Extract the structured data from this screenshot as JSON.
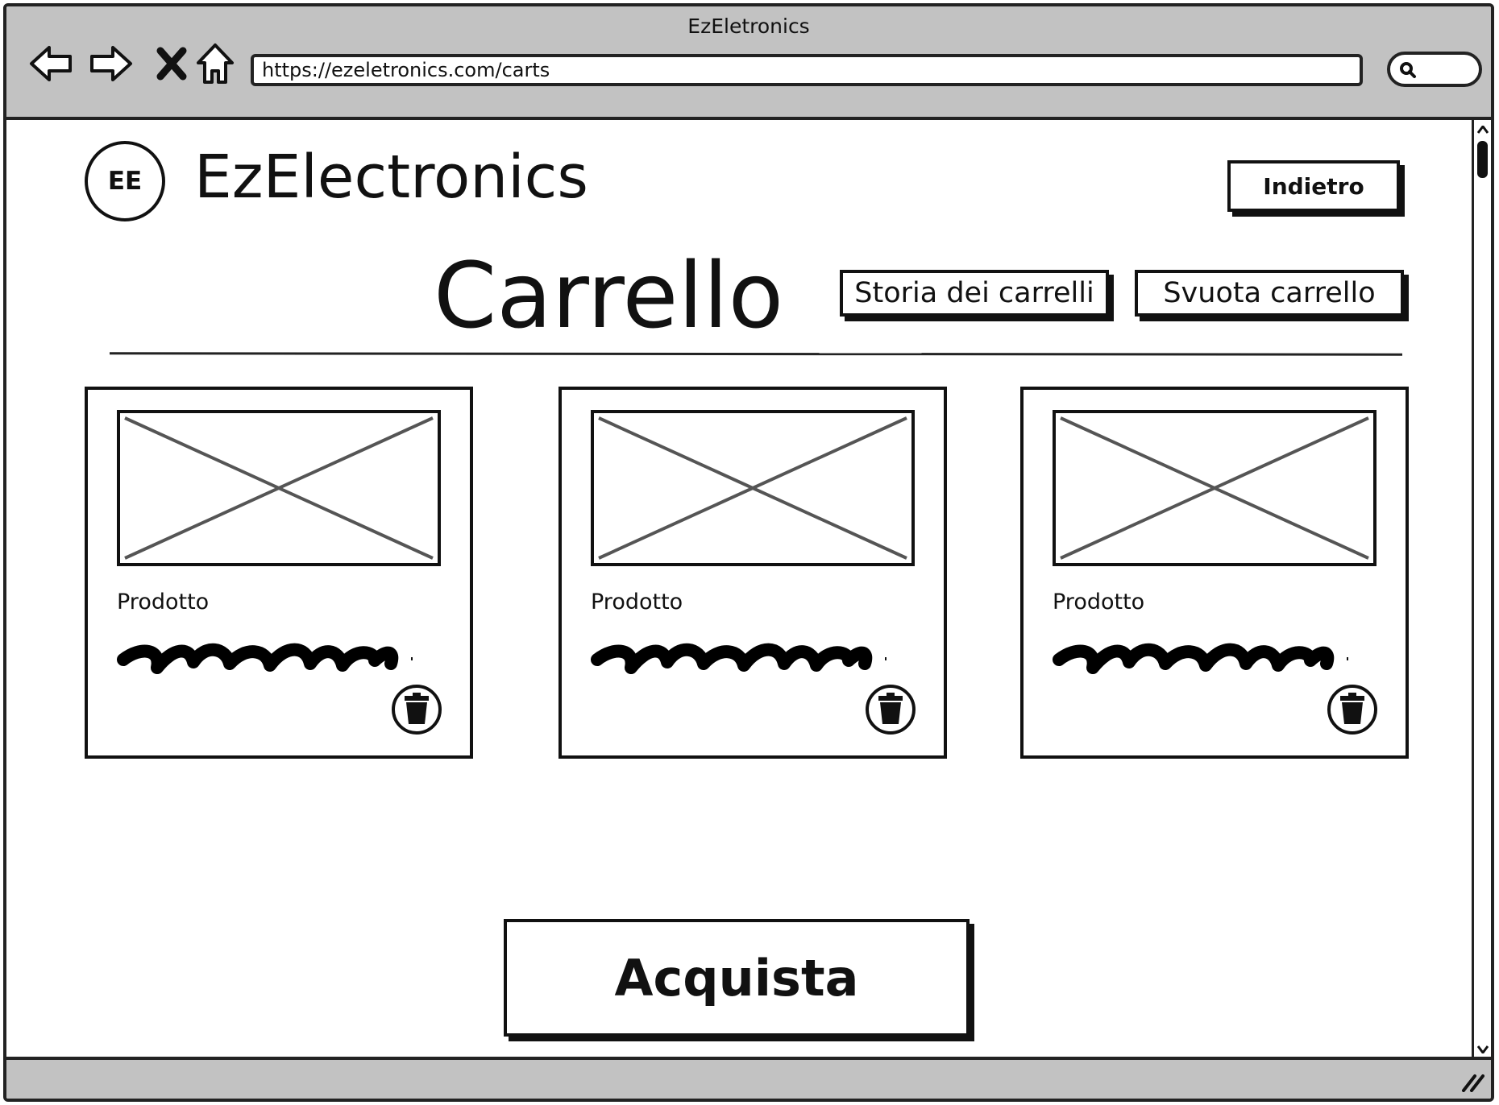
{
  "browser": {
    "window_title": "EzEletronics",
    "url": "https://ezeletronics.com/carts"
  },
  "header": {
    "logo_text": "EE",
    "brand_name": "EzElectronics",
    "back_label": "Indietro"
  },
  "page": {
    "title": "Carrello",
    "history_label": "Storia dei carrelli",
    "empty_label": "Svuota carrello"
  },
  "products": [
    {
      "name": "Prodotto",
      "image_icon": "image-placeholder-icon",
      "delete_icon": "trash-icon"
    },
    {
      "name": "Prodotto",
      "image_icon": "image-placeholder-icon",
      "delete_icon": "trash-icon"
    },
    {
      "name": "Prodotto",
      "image_icon": "image-placeholder-icon",
      "delete_icon": "trash-icon"
    }
  ],
  "actions": {
    "buy_label": "Acquista"
  },
  "colors": {
    "chrome": "#c2c2c2",
    "ink": "#111111",
    "placeholder_lines": "#555555"
  }
}
